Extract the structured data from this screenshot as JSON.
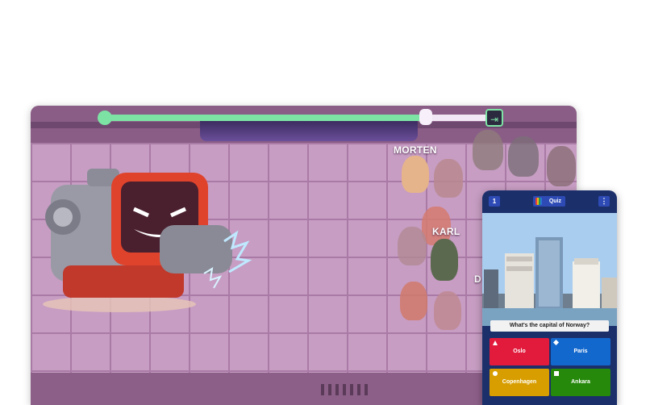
{
  "game": {
    "progress_fraction": 0.82,
    "players": [
      {
        "name": "MORTEN"
      },
      {
        "name": "KARL"
      },
      {
        "name": "D"
      }
    ]
  },
  "quiz_panel": {
    "question_number": "1",
    "title": "Quiz",
    "menu_glyph": "⋮",
    "question": "What's the capital of Norway?",
    "answers": [
      {
        "label": "Oslo",
        "color": "#e21b3c",
        "shape": "triangle-icon"
      },
      {
        "label": "Paris",
        "color": "#1368ce",
        "shape": "diamond-icon"
      },
      {
        "label": "Copenhagen",
        "color": "#d89e00",
        "shape": "circle-icon"
      },
      {
        "label": "Ankara",
        "color": "#26890c",
        "shape": "square-icon"
      }
    ]
  },
  "colors": {
    "progress": "#7de3a4",
    "robot_screen": "#e8452e",
    "floor": "#c79dc3"
  }
}
